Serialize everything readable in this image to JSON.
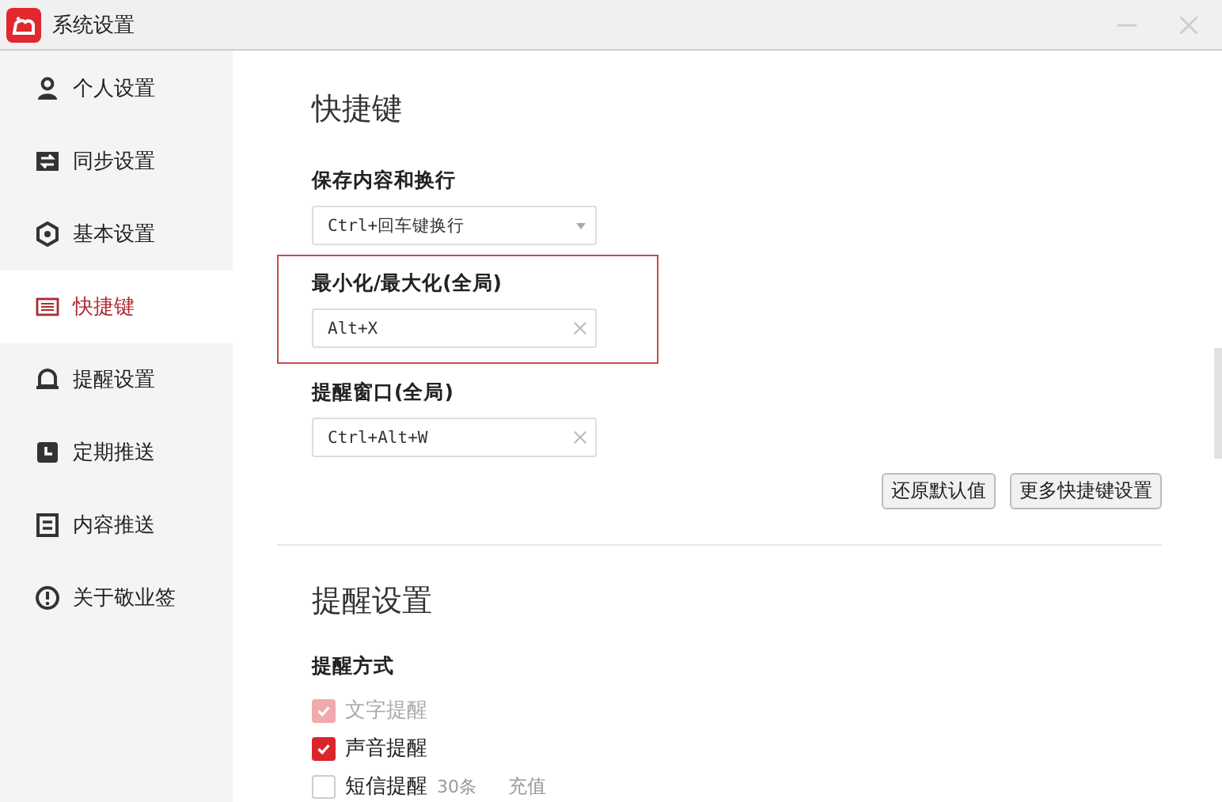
{
  "window": {
    "title": "系统设置"
  },
  "sidebar": {
    "items": [
      {
        "label": "个人设置",
        "kind": "person",
        "selected": false
      },
      {
        "label": "同步设置",
        "kind": "sync",
        "selected": false
      },
      {
        "label": "基本设置",
        "kind": "hexagon",
        "selected": false
      },
      {
        "label": "快捷键",
        "kind": "keyboard",
        "selected": true
      },
      {
        "label": "提醒设置",
        "kind": "bell",
        "selected": false
      },
      {
        "label": "定期推送",
        "kind": "clock",
        "selected": false
      },
      {
        "label": "内容推送",
        "kind": "doc",
        "selected": false
      },
      {
        "label": "关于敬业签",
        "kind": "info",
        "selected": false
      }
    ]
  },
  "shortcuts": {
    "title": "快捷键",
    "fields": [
      {
        "label": "保存内容和换行",
        "kind": "select",
        "value": "Ctrl+回车键换行",
        "highlighted": false
      },
      {
        "label": "最小化/最大化(全局)",
        "kind": "input",
        "value": "Alt+X",
        "highlighted": true
      },
      {
        "label": "提醒窗口(全局)",
        "kind": "input",
        "value": "Ctrl+Alt+W",
        "highlighted": false
      }
    ],
    "buttons": [
      "还原默认值",
      "更多快捷键设置"
    ]
  },
  "reminders": {
    "title": "提醒设置",
    "group_label": "提醒方式",
    "options": [
      {
        "label": "文字提醒",
        "checked": true,
        "disabled": true
      },
      {
        "label": "声音提醒",
        "checked": true,
        "disabled": false
      },
      {
        "label": "短信提醒",
        "checked": false,
        "disabled": false,
        "note": "30条",
        "link": "充值"
      }
    ]
  }
}
